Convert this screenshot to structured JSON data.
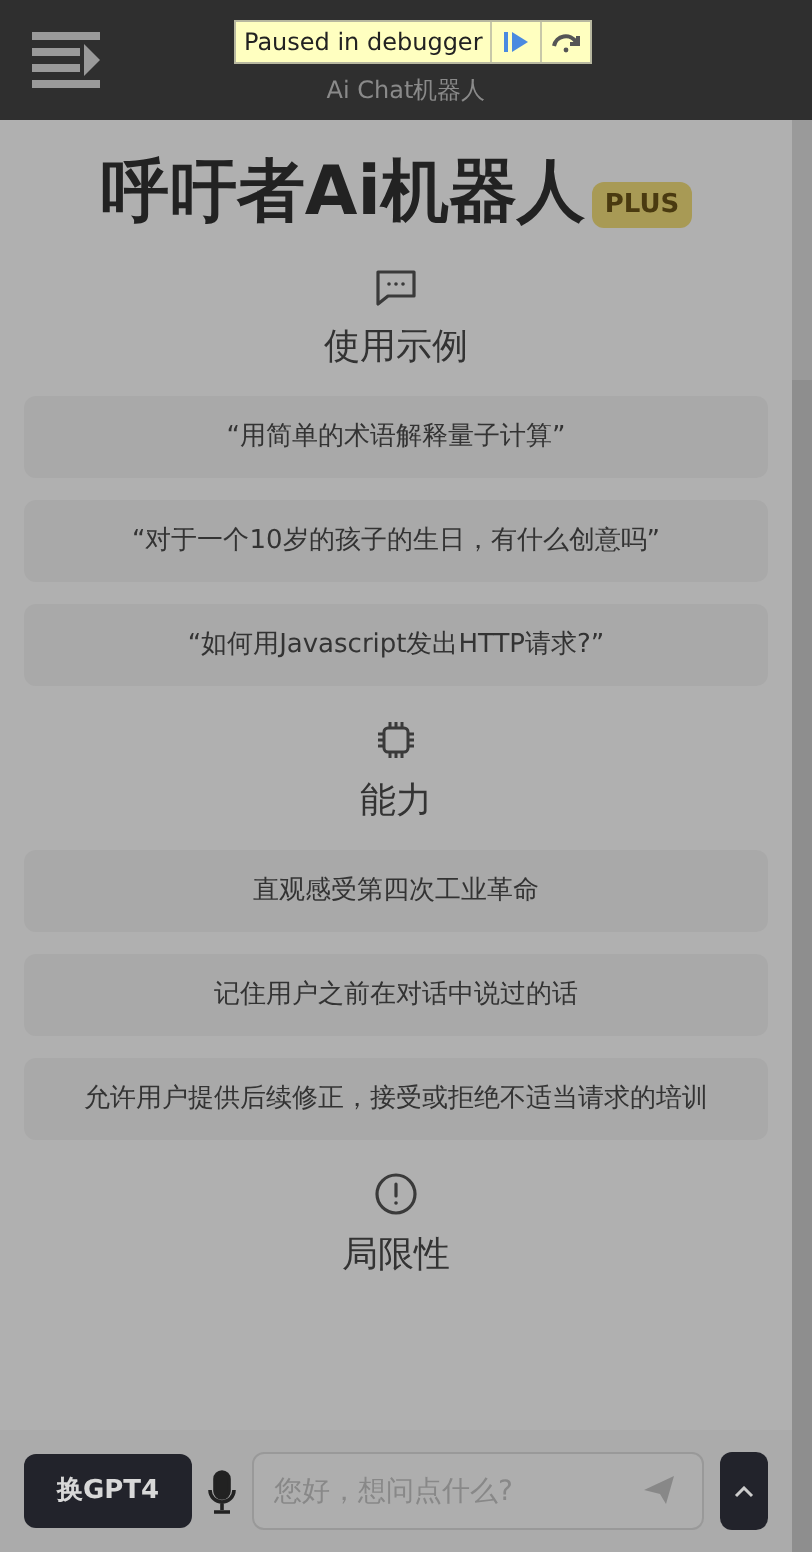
{
  "debugger": {
    "label": "Paused in debugger"
  },
  "header": {
    "title": "Ai Chat机器人"
  },
  "hero": {
    "title": "呼吁者Ai机器人",
    "badge": "PLUS"
  },
  "sections": [
    {
      "kind": "examples",
      "heading": "使用示例",
      "items": [
        "“用简单的术语解释量子计算”",
        "“对于一个10岁的孩子的生日，有什么创意吗”",
        "“如何用Javascript发出HTTP请求?”"
      ]
    },
    {
      "kind": "capabilities",
      "heading": "能力",
      "items": [
        "直观感受第四次工业革命",
        "记住用户之前在对话中说过的话",
        "允许用户提供后续修正，接受或拒绝不适当请求的培训"
      ]
    },
    {
      "kind": "limitations",
      "heading": "局限性"
    }
  ],
  "composer": {
    "model_button": "换GPT4",
    "placeholder": "您好，想问点什么?"
  }
}
